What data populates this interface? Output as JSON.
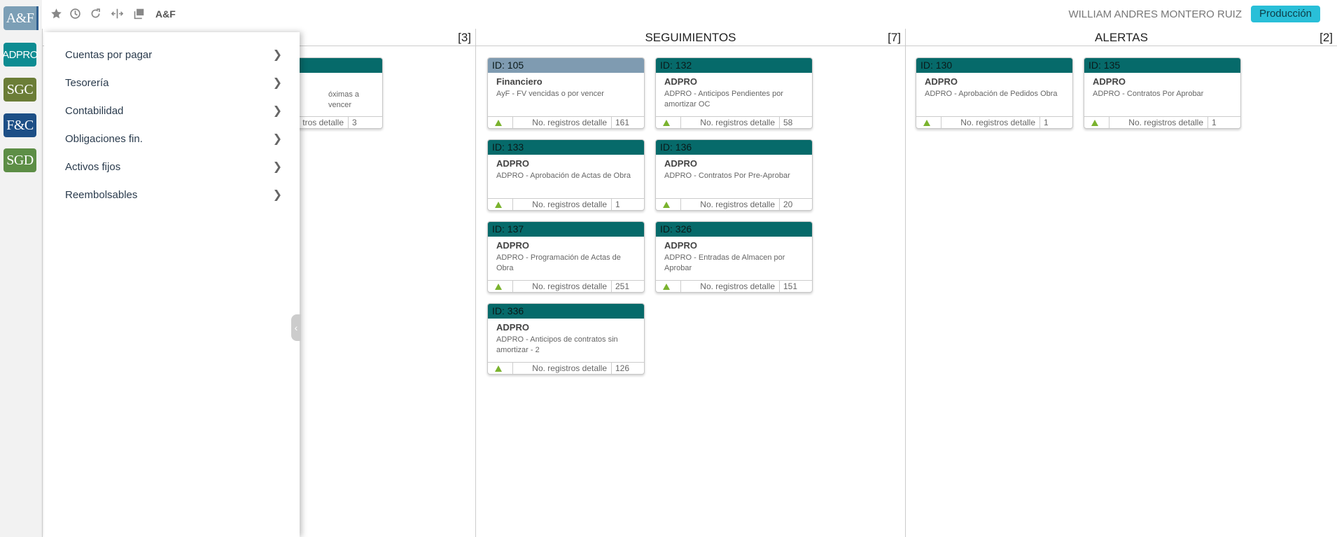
{
  "modules": [
    {
      "label": "A&F",
      "color": "#7c9fb6"
    },
    {
      "label": "ADPRO",
      "color": "#0d8c92"
    },
    {
      "label": "SGC",
      "color": "#6b7d37"
    },
    {
      "label": "F&C",
      "color": "#1d4f86"
    },
    {
      "label": "SGD",
      "color": "#5d8e46"
    }
  ],
  "toolbar": {
    "brand": "A&F",
    "user": "WILLIAM ANDRES MONTERO RUIZ",
    "environment": "Producción"
  },
  "columns": [
    {
      "title": "",
      "count": "[3]"
    },
    {
      "title": "SEGUIMIENTOS",
      "count": "[7]"
    },
    {
      "title": "ALERTAS",
      "count": "[2]"
    }
  ],
  "footer_label": "No. registros detalle",
  "partial_card": {
    "desc": "óximas a vencer",
    "label": "tros detalle",
    "value": "3"
  },
  "seguimientos": [
    {
      "id": "ID: 105",
      "title": "Financiero",
      "desc": "AyF - FV vencidas o por vencer",
      "value": "161"
    },
    {
      "id": "ID: 132",
      "title": "ADPRO",
      "desc": "ADPRO - Anticipos Pendientes por amortizar OC",
      "value": "58"
    },
    {
      "id": "ID: 133",
      "title": "ADPRO",
      "desc": "ADPRO - Aprobación de Actas de Obra",
      "value": "1"
    },
    {
      "id": "ID: 136",
      "title": "ADPRO",
      "desc": "ADPRO - Contratos Por Pre-Aprobar",
      "value": "20"
    },
    {
      "id": "ID: 137",
      "title": "ADPRO",
      "desc": "ADPRO - Programación de Actas de Obra",
      "value": "251"
    },
    {
      "id": "ID: 326",
      "title": "ADPRO",
      "desc": "ADPRO - Entradas de Almacen por Aprobar",
      "value": "151"
    },
    {
      "id": "ID: 336",
      "title": "ADPRO",
      "desc": "ADPRO - Anticipos de contratos sin amortizar - 2",
      "value": "126"
    }
  ],
  "alertas": [
    {
      "id": "ID: 130",
      "title": "ADPRO",
      "desc": "ADPRO - Aprobación de Pedidos Obra",
      "value": "1"
    },
    {
      "id": "ID: 135",
      "title": "ADPRO",
      "desc": "ADPRO - Contratos Por Aprobar",
      "value": "1"
    }
  ],
  "menu": [
    {
      "label": "Cuentas por pagar"
    },
    {
      "label": "Tesorería"
    },
    {
      "label": "Contabilidad"
    },
    {
      "label": "Obligaciones fin."
    },
    {
      "label": "Activos fijos"
    },
    {
      "label": "Reembolsables"
    }
  ],
  "icons": {
    "star": "star-icon",
    "history": "clock-icon",
    "refresh": "refresh-icon",
    "split": "split-view-icon",
    "windows": "windows-icon",
    "chevron": "chevron-right-icon",
    "collapse": "chevron-left-icon",
    "arrow": "triangle-up-icon"
  },
  "colors": {
    "card_header": "#066a6a",
    "card_header_alt": "#7f9bb1",
    "env_badge": "#29bfd8",
    "arrow": "#7ab32e"
  }
}
